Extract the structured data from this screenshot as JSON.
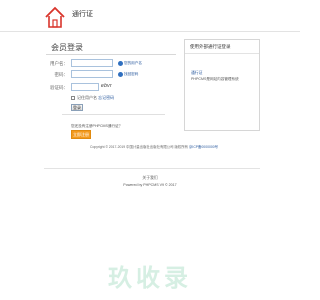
{
  "header": {
    "logo_icon": "house-icon",
    "title": "通行证"
  },
  "login": {
    "title": "会员登录",
    "username_label": "用户名：",
    "username_value": "",
    "username_hint": "您的用户名",
    "password_label": "密码：",
    "password_value": "",
    "password_hint": "找回密码",
    "captcha_label": "验证码：",
    "captcha_value": "",
    "captcha_text": "ebvr",
    "remember_label": "记住用户名",
    "remember_link": "忘记密码",
    "submit_label": "登录"
  },
  "register": {
    "prompt": "您还没有注册PHPCMS通行证？",
    "button_label": "立即注册"
  },
  "external": {
    "title": "使用外部通行证登录",
    "link_text": "通行证",
    "description": "PHPCMS是网站内容管理系统"
  },
  "copyright": {
    "text": "Copyright © 2017-2019 中国计量出版社出版社有限公司 版权所有",
    "link": "京ICP备0000000号"
  },
  "footer": {
    "link": "关于我们",
    "powered": "Powered by PHPCMS V9 © 2017"
  },
  "watermark": {
    "text": "玖收录"
  },
  "colors": {
    "accent_orange": "#f39a1e",
    "link_blue": "#2a5a9e",
    "logo_red": "#d9342b"
  }
}
